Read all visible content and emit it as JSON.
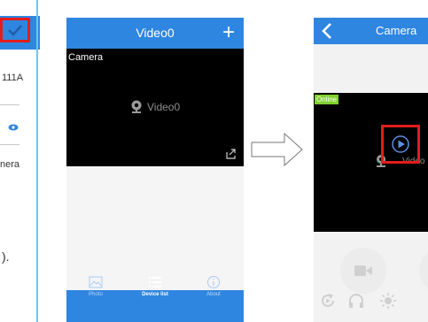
{
  "left_panel": {
    "device_id_partial": "111A",
    "device_name_partial": "nera",
    "note_tail": ")."
  },
  "middle_screen": {
    "title": "Video0",
    "video_tile": {
      "camera_label": "Camera",
      "stream_label": "Video0"
    },
    "tabs": [
      {
        "label": "Photo",
        "icon": "image-icon"
      },
      {
        "label": "Device list",
        "icon": "list-icon"
      },
      {
        "label": "About",
        "icon": "info-icon"
      }
    ]
  },
  "right_screen": {
    "title": "Camera",
    "status_badge": "Online",
    "stream_label_partial": "Video",
    "toolbar_icons": [
      "refresh-icon",
      "headphones-icon",
      "brightness-icon"
    ]
  },
  "colors": {
    "brand_blue": "#2f86e0",
    "highlight_red": "#e31d1d",
    "online_green": "#7fd12a"
  }
}
